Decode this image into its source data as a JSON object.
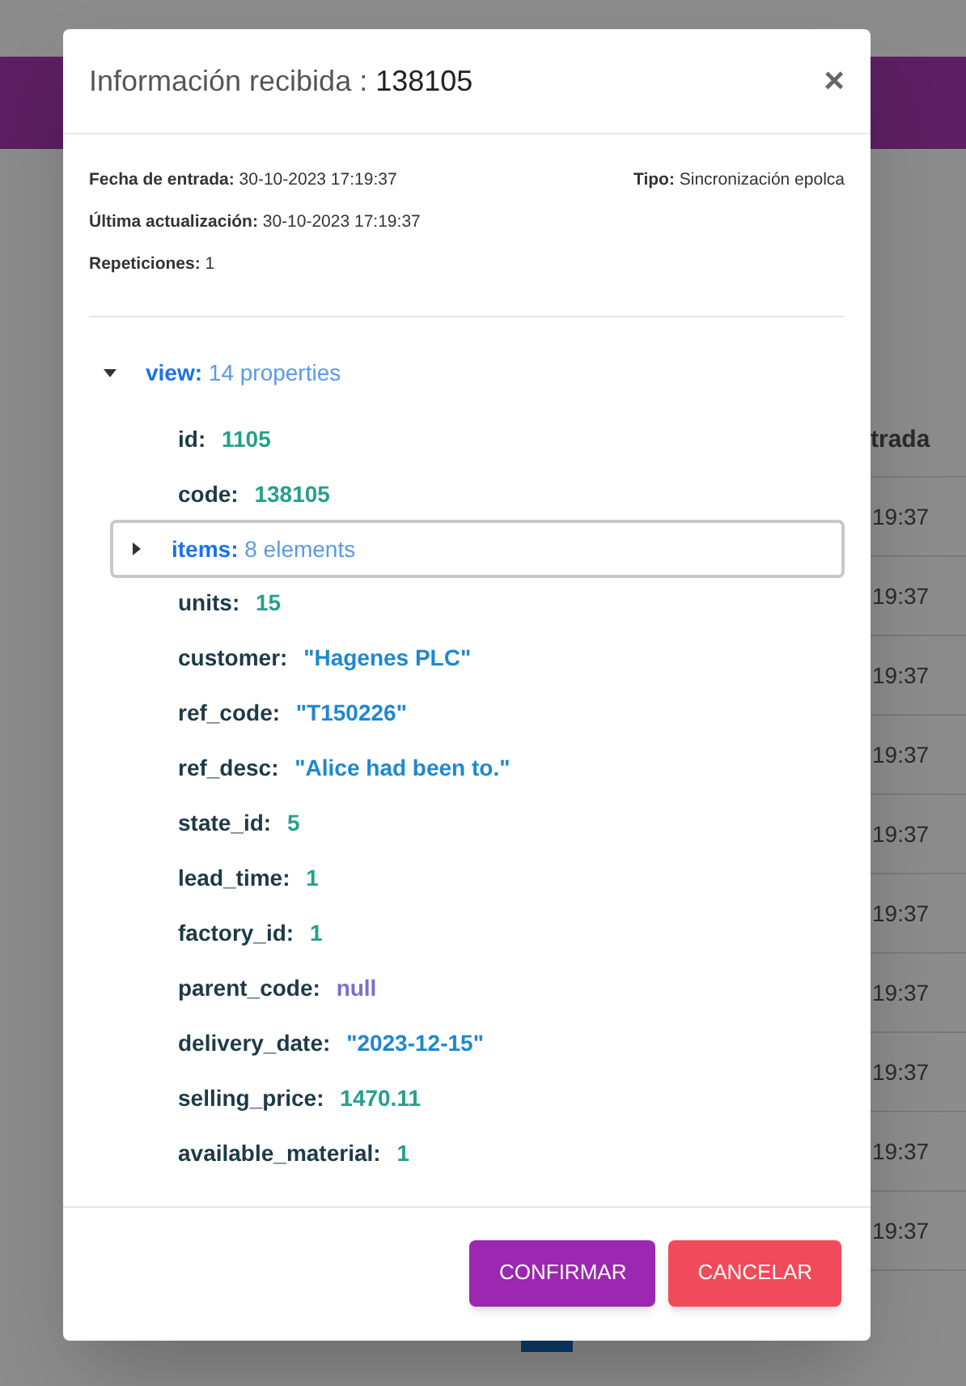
{
  "background": {
    "column_header": "trada",
    "rows": [
      "19:37",
      "19:37",
      "19:37",
      "19:37",
      "19:37",
      "19:37",
      "19:37",
      "19:37",
      "19:37",
      "19:37"
    ]
  },
  "dialog": {
    "title": "Información recibida",
    "separator": ":",
    "code": "138105",
    "close": "×",
    "info_left": [
      {
        "label": "Fecha de entrada:",
        "value": "30-10-2023 17:19:37"
      },
      {
        "label": "Última actualización:",
        "value": "30-10-2023 17:19:37"
      },
      {
        "label": "Repeticiones:",
        "value": "1"
      }
    ],
    "info_right": {
      "label": "Tipo:",
      "value": "Sincronización epolca"
    },
    "tree": {
      "key": "view:",
      "summary": "14 properties",
      "expanded": true,
      "children": [
        {
          "kind": "value",
          "key": "id:",
          "value": "1105",
          "color": "#26a08a"
        },
        {
          "kind": "value",
          "key": "code:",
          "value": "138105",
          "color": "#26a08a"
        },
        {
          "kind": "node",
          "key": "items:",
          "summary": "8 elements",
          "expanded": false,
          "selected": true
        },
        {
          "kind": "value",
          "key": "units:",
          "value": "15",
          "color": "#26a08a"
        },
        {
          "kind": "value",
          "key": "customer:",
          "value": "\"Hagenes PLC\"",
          "color": "#1e88d0"
        },
        {
          "kind": "value",
          "key": "ref_code:",
          "value": "\"T150226\"",
          "color": "#1e88d0"
        },
        {
          "kind": "value",
          "key": "ref_desc:",
          "value": "\"Alice had been to.\"",
          "color": "#1e88d0"
        },
        {
          "kind": "value",
          "key": "state_id:",
          "value": "5",
          "color": "#26a08a"
        },
        {
          "kind": "value",
          "key": "lead_time:",
          "value": "1",
          "color": "#26a08a"
        },
        {
          "kind": "value",
          "key": "factory_id:",
          "value": "1",
          "color": "#26a08a"
        },
        {
          "kind": "value",
          "key": "parent_code:",
          "value": "null",
          "color": "#7a70c8"
        },
        {
          "kind": "value",
          "key": "delivery_date:",
          "value": "\"2023-12-15\"",
          "color": "#1e88d0"
        },
        {
          "kind": "value",
          "key": "selling_price:",
          "value": "1470.11",
          "color": "#26a08a"
        },
        {
          "kind": "value",
          "key": "available_material:",
          "value": "1",
          "color": "#26a08a"
        }
      ]
    },
    "buttons": [
      {
        "label": "CONFIRMAR",
        "kind": "primary"
      },
      {
        "label": "CANCELAR",
        "kind": "danger"
      }
    ]
  }
}
